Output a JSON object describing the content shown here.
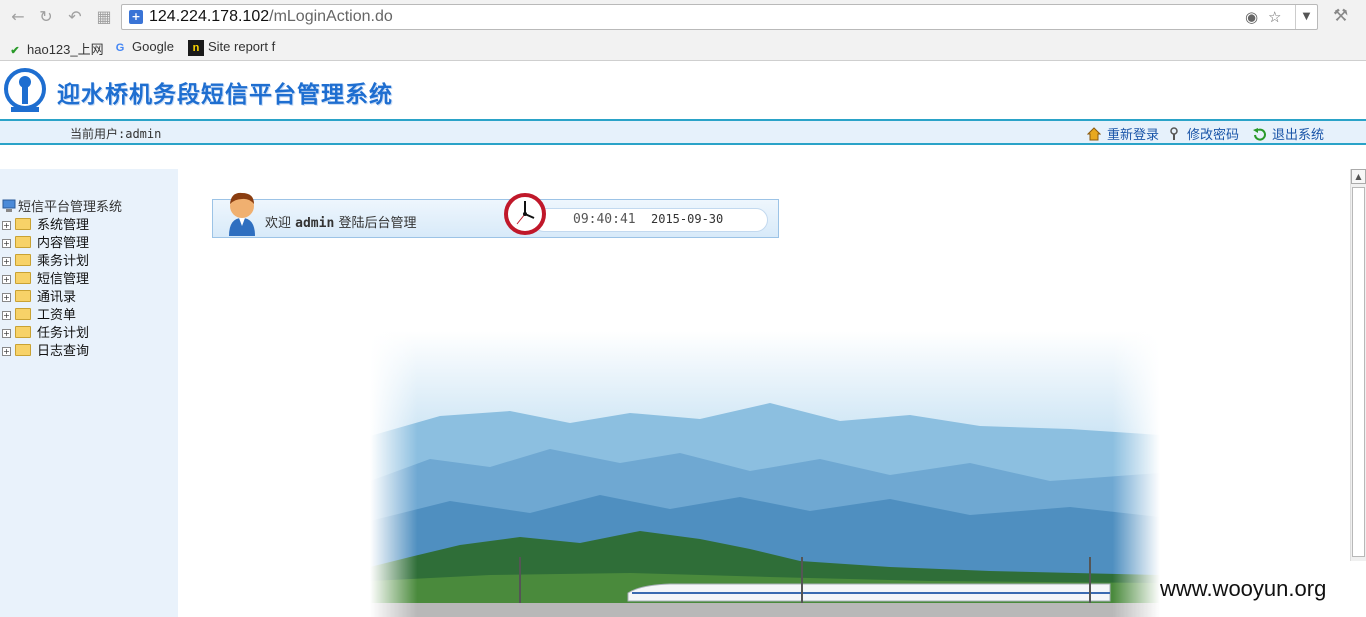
{
  "browser": {
    "url_host": "124.224.178.102",
    "url_path": "/mLoginAction.do",
    "bookmarks": [
      {
        "label": "hao123_上网",
        "icon": "hao123-icon"
      },
      {
        "label": "Google",
        "icon": "google-icon"
      },
      {
        "label": "Site report f",
        "icon": "netcraft-icon"
      }
    ]
  },
  "header": {
    "title": "迎水桥机务段短信平台管理系统",
    "current_user": "当前用户:admin",
    "links": {
      "relogin": "重新登录",
      "change_password": "修改密码",
      "exit": "退出系统"
    }
  },
  "sidebar": {
    "root": "短信平台管理系统",
    "items": [
      "系统管理",
      "内容管理",
      "乘务计划",
      "短信管理",
      "通讯录",
      "工资单",
      "任务计划",
      "日志查询"
    ]
  },
  "welcome": {
    "prefix": "欢迎",
    "user": "admin",
    "suffix": "登陆后台管理",
    "time": "09:40:41",
    "date": "2015-09-30"
  },
  "watermark": "www.wooyun.org",
  "colors": {
    "title_blue": "#1e6ed0",
    "bar_border": "#2aa3c8",
    "bar_bg": "#e6f1fb",
    "sidebar_bg": "#e9f2fb"
  }
}
